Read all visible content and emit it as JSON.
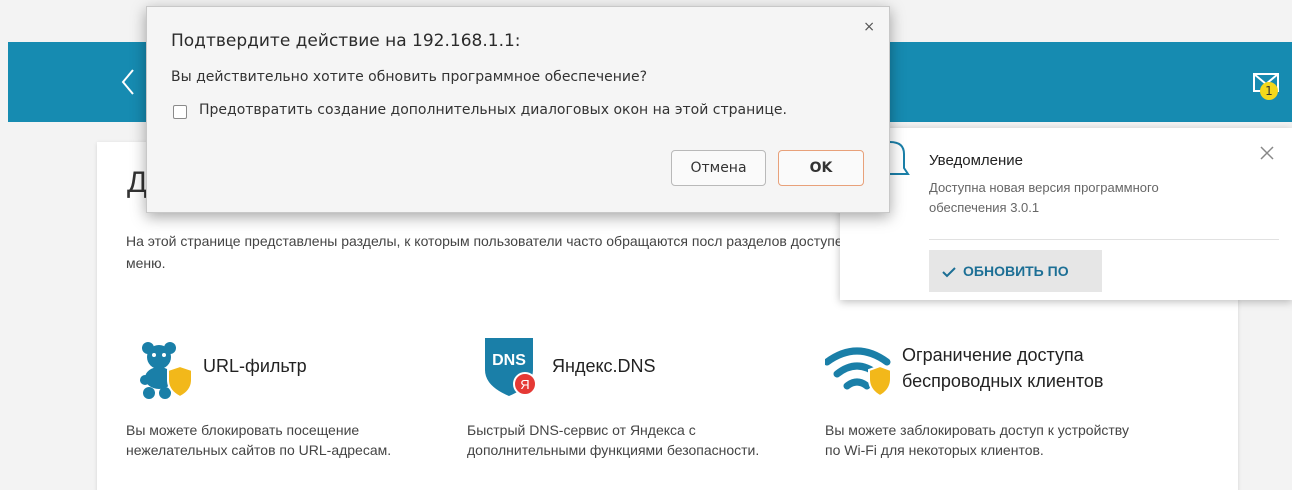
{
  "dialog": {
    "title": "Подтвердите действие на 192.168.1.1:",
    "message": "Вы действительно хотите обновить программное обеспечение?",
    "checkbox_label": "Предотвратить создание дополнительных диалоговых окон на этой странице.",
    "cancel_label": "Отмена",
    "ok_label": "OK",
    "close_glyph": "×"
  },
  "header": {
    "badge_count": "1"
  },
  "page": {
    "title": "Д",
    "intro": "На этой странице представлены разделы, к которым пользователи часто обращаются посл разделов доступен в меню."
  },
  "tiles": [
    {
      "title": "URL-фильтр",
      "description": "Вы можете блокировать посещение нежелательных сайтов по URL-адресам.",
      "icon": "teddy-bear-shield-icon"
    },
    {
      "title": "Яндекс.DNS",
      "icon_text": "DNS",
      "icon_badge": "Я",
      "description": "Быстрый DNS-сервис от Яндекса с дополнительными функциями безопасности.",
      "icon": "yandex-dns-icon"
    },
    {
      "title": "Ограничение доступа беспроводных клиентов",
      "description": "Вы можете заблокировать доступ к устройству по Wi-Fi для некоторых клиентов.",
      "icon": "wifi-shield-icon"
    }
  ],
  "notification": {
    "title": "Уведомление",
    "text": "Доступна новая версия программного обеспечения 3.0.1",
    "button_label": "ОБНОВИТЬ ПО"
  },
  "colors": {
    "header": "#168bb1",
    "accent": "#1c6f95",
    "badge": "#f4d81c",
    "shield": "#f2b81a"
  }
}
